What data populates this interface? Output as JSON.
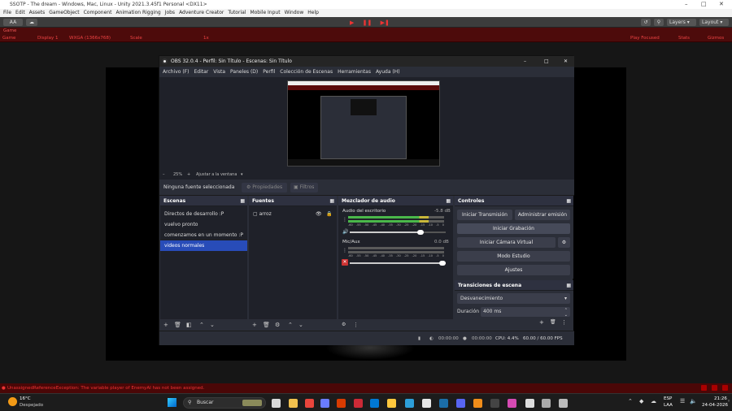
{
  "unity": {
    "title": "SSOTP - The dream - Windows, Mac, Linux - Unity 2021.3.45f1 Personal <DX11>",
    "menu": [
      "File",
      "Edit",
      "Assets",
      "GameObject",
      "Component",
      "Animation Rigging",
      "Jobs",
      "Adventure Creator",
      "Tutorial",
      "Mobile Input",
      "Window",
      "Help"
    ],
    "toolbar": {
      "account": "AA",
      "layers": "Layers",
      "layout": "Layout"
    },
    "game_tab": "Game",
    "game_bar": {
      "display": "Game",
      "display_num": "Display 1",
      "resolution": "WXGA (1366x768)",
      "scale_label": "Scale",
      "scale_value": "1x",
      "play_focused": "Play Focused",
      "stats": "Stats",
      "gizmos": "Gizmos"
    },
    "console_error": "UnassignedReferenceException: The variable player of EnemyAI has not been assigned."
  },
  "obs": {
    "title": "OBS 32.0.4 - Perfil: Sin Título - Escenas: Sin Título",
    "menu": [
      "Archivo (F)",
      "Editar",
      "Vista",
      "Paneles (D)",
      "Perfil",
      "Colección de Escenas",
      "Herramientas",
      "Ayuda (H)"
    ],
    "zoom": {
      "value": "25%",
      "fit": "Ajustar a la ventana"
    },
    "source_bar": {
      "no_source": "Ninguna fuente seleccionada",
      "properties": "Propiedades",
      "filters": "Filtros"
    },
    "scenes": {
      "title": "Escenas",
      "items": [
        "Directos de desarrollo :P",
        "vuelvo pronto",
        "comenzamos en un momento :P",
        "videos normales"
      ],
      "selected_index": 3
    },
    "sources": {
      "title": "Fuentes",
      "items": [
        "arroz"
      ]
    },
    "mixer": {
      "title": "Mezclador de audio",
      "ticks": [
        "-60",
        "-55",
        "-50",
        "-45",
        "-40",
        "-35",
        "-30",
        "-25",
        "-20",
        "-15",
        "-10",
        "-5",
        "0"
      ],
      "channels": [
        {
          "name": "Audio del escritorio",
          "db": "-5.8 dB",
          "volume": 0.75,
          "muted": false
        },
        {
          "name": "Mic/Aux",
          "db": "0.0 dB",
          "volume": 1.0,
          "muted": true
        }
      ]
    },
    "controls": {
      "title": "Controles",
      "start_stream": "Iniciar Transmisión",
      "manage_broadcast": "Administrar emisión",
      "start_recording": "Iniciar Grabación",
      "virtual_camera": "Iniciar Cámara Virtual",
      "studio_mode": "Modo Estudio",
      "settings": "Ajustes"
    },
    "transitions": {
      "title": "Transiciones de escena",
      "type": "Desvanecimiento",
      "duration_label": "Duración",
      "duration_value": "400 ms"
    },
    "status": {
      "stream_time": "00:00:00",
      "rec_time": "00:00:00",
      "cpu": "CPU: 4.4%",
      "fps": "60.00 / 60.00 FPS"
    }
  },
  "taskbar": {
    "weather_temp": "16°C",
    "weather_desc": "Despejado",
    "search": "Buscar",
    "lang": "ESP",
    "lang_sub": "LAA",
    "time": "21:26",
    "date": "24-04-2026"
  },
  "colors": {
    "obs_bg": "#2b2e38",
    "obs_dock": "#1f2129",
    "obs_select": "#284cb8",
    "unity_play_red": "#4d0b0b",
    "error_red": "#e33"
  }
}
